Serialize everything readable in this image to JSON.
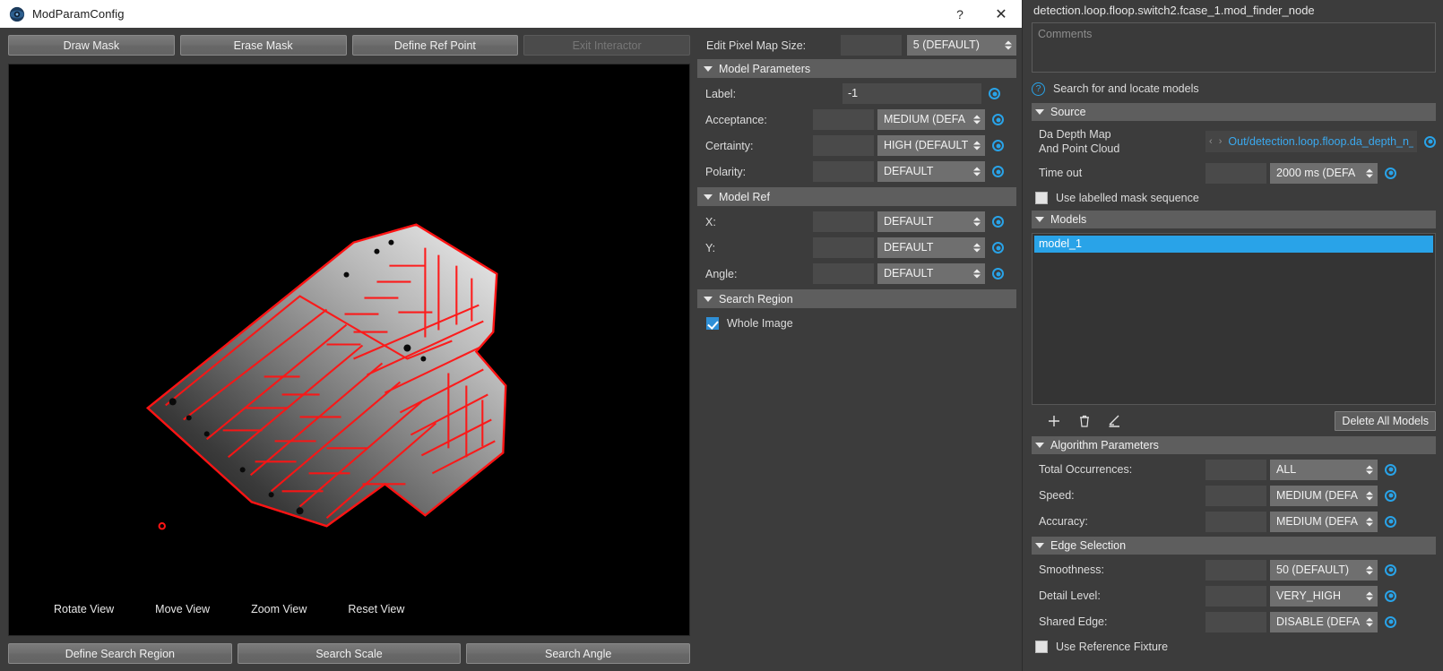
{
  "window": {
    "title": "ModParamConfig",
    "icon": "app-eye-icon",
    "help_label": "?",
    "close_label": "✕"
  },
  "mask_toolbar": {
    "buttons": [
      {
        "label": "Draw Mask",
        "enabled": true
      },
      {
        "label": "Erase Mask",
        "enabled": true
      },
      {
        "label": "Define Ref Point",
        "enabled": true
      },
      {
        "label": "Exit Interactor",
        "enabled": false
      }
    ]
  },
  "viewer": {
    "view_controls": [
      "Rotate View",
      "Move View",
      "Zoom View",
      "Reset View"
    ],
    "bottom_buttons": [
      "Define Search Region",
      "Search Scale",
      "Search Angle"
    ]
  },
  "params": {
    "pixel_map": {
      "label": "Edit Pixel Map Size:",
      "value": "",
      "dropdown": "5 (DEFAULT)"
    },
    "model_parameters": {
      "header": "Model Parameters",
      "rows": [
        {
          "label": "Label:",
          "value": "-1",
          "type": "text"
        },
        {
          "label": "Acceptance:",
          "value": "",
          "dropdown": "MEDIUM (DEFA",
          "type": "combo"
        },
        {
          "label": "Certainty:",
          "value": "",
          "dropdown": "HIGH (DEFAULT",
          "type": "combo"
        },
        {
          "label": "Polarity:",
          "value": "",
          "dropdown": "DEFAULT",
          "type": "combo"
        }
      ]
    },
    "model_ref": {
      "header": "Model Ref",
      "rows": [
        {
          "label": "X:",
          "value": "",
          "dropdown": "DEFAULT"
        },
        {
          "label": "Y:",
          "value": "",
          "dropdown": "DEFAULT"
        },
        {
          "label": "Angle:",
          "value": "",
          "dropdown": "DEFAULT"
        }
      ]
    },
    "search_region": {
      "header": "Search Region",
      "whole_image_label": "Whole Image",
      "whole_image_checked": true
    }
  },
  "properties": {
    "node_path": "detection.loop.floop.switch2.fcase_1.mod_finder_node",
    "comments_placeholder": "Comments",
    "description": "Search for and locate models",
    "source": {
      "header": "Source",
      "depth_map_label": "Da Depth Map\nAnd Point Cloud",
      "depth_map_label_line1": "Da Depth Map",
      "depth_map_label_line2": "And Point Cloud",
      "depth_map_link": "Out/detection.loop.floop.da_depth_n_clo",
      "nav_arrows": "‹ ›",
      "timeout_label": "Time out",
      "timeout_value": "",
      "timeout_dropdown": "2000 ms (DEFA",
      "masked_seq_label": "Use labelled mask sequence",
      "masked_seq_checked": false
    },
    "models": {
      "header": "Models",
      "items": [
        "model_1"
      ],
      "selected": "model_1",
      "tools": [
        {
          "name": "add-model-icon",
          "glyph": "+"
        },
        {
          "name": "delete-model-icon",
          "glyph": "trash"
        },
        {
          "name": "edit-model-icon",
          "glyph": "pencil"
        }
      ],
      "delete_all_label": "Delete All Models"
    },
    "algorithm": {
      "header": "Algorithm Parameters",
      "rows": [
        {
          "label": "Total Occurrences:",
          "value": "",
          "dropdown": "ALL"
        },
        {
          "label": "Speed:",
          "value": "",
          "dropdown": "MEDIUM (DEFA"
        },
        {
          "label": "Accuracy:",
          "value": "",
          "dropdown": "MEDIUM (DEFA"
        }
      ]
    },
    "edge_selection": {
      "header": "Edge Selection",
      "rows": [
        {
          "label": "Smoothness:",
          "value": "",
          "dropdown": "50 (DEFAULT)"
        },
        {
          "label": "Detail Level:",
          "value": "",
          "dropdown": "VERY_HIGH"
        },
        {
          "label": "Shared Edge:",
          "value": "",
          "dropdown": "DISABLE (DEFA"
        }
      ],
      "ref_fixture_label": "Use Reference Fixture",
      "ref_fixture_checked": false
    }
  },
  "colors": {
    "accent_blue": "#29a3e8",
    "selection_blue": "#29a3e8",
    "link_blue": "#3aa9ef",
    "panel_bg": "#3c3c3c",
    "section_header": "#5e5e5e",
    "edge_overlay_red": "#ff0000"
  }
}
